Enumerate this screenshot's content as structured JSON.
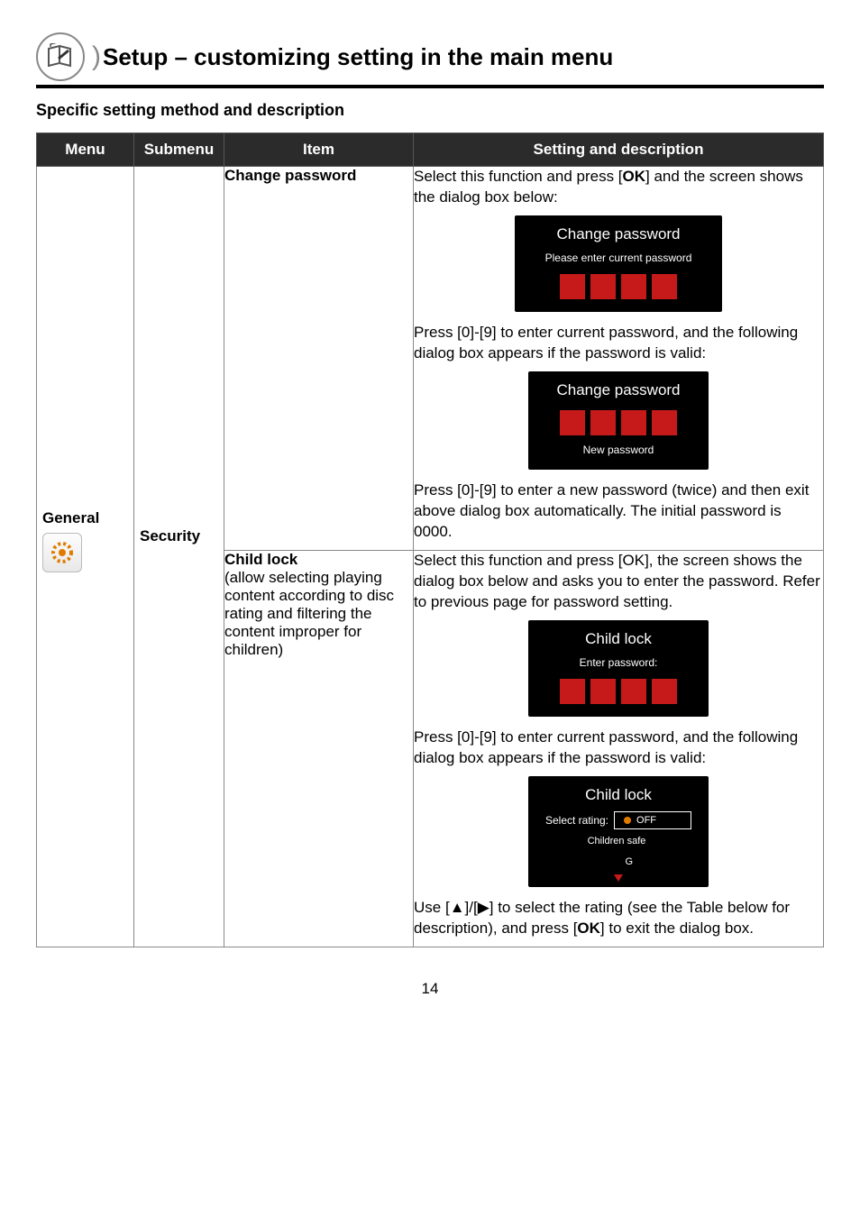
{
  "header": {
    "title": "Setup – customizing setting in the main menu"
  },
  "subheading": "Specific setting method and description",
  "table": {
    "headers": {
      "menu": "Menu",
      "submenu": "Submenu",
      "item": "Item",
      "desc": "Setting and description"
    },
    "menu": "General",
    "submenu": "Security",
    "rows": [
      {
        "item_title": "Change password",
        "desc_p1_a": "Select this function and press [",
        "desc_p1_ok": "OK",
        "desc_p1_b": "] and the screen shows the dialog box below:",
        "dlg1_title": "Change password",
        "dlg1_sub": "Please enter current password",
        "desc_p2": "Press [0]-[9] to enter current password, and the following dialog box appears if the password is valid:",
        "dlg2_title": "Change password",
        "dlg2_sub": "New password",
        "desc_p3": "Press [0]-[9] to enter a new password (twice) and then exit above dialog box automatically. The initial password is 0000."
      },
      {
        "item_title": "Child lock",
        "item_body": "(allow selecting playing content according to disc rating and filtering the content improper for children)",
        "desc_p1": "Select this function and press [OK], the screen shows the dialog box below and asks you to enter the password. Refer to previous page for password setting.",
        "dlg1_title": "Child lock",
        "dlg1_sub": "Enter password:",
        "desc_p2": "Press [0]-[9] to enter current password, and the following dialog box appears if the password is valid:",
        "dlg2_title": "Child lock",
        "dlg2_rating_label": "Select rating:",
        "dlg2_opt1": "OFF",
        "dlg2_opt2": "Children safe",
        "dlg2_opt3": "G",
        "desc_p3_a": "Use [",
        "desc_p3_b": "]/[",
        "desc_p3_c": "] to select the rating (see the Table below for description), and press [",
        "desc_p3_ok": "OK",
        "desc_p3_d": "] to exit the dialog box."
      }
    ]
  },
  "page_number": "14"
}
